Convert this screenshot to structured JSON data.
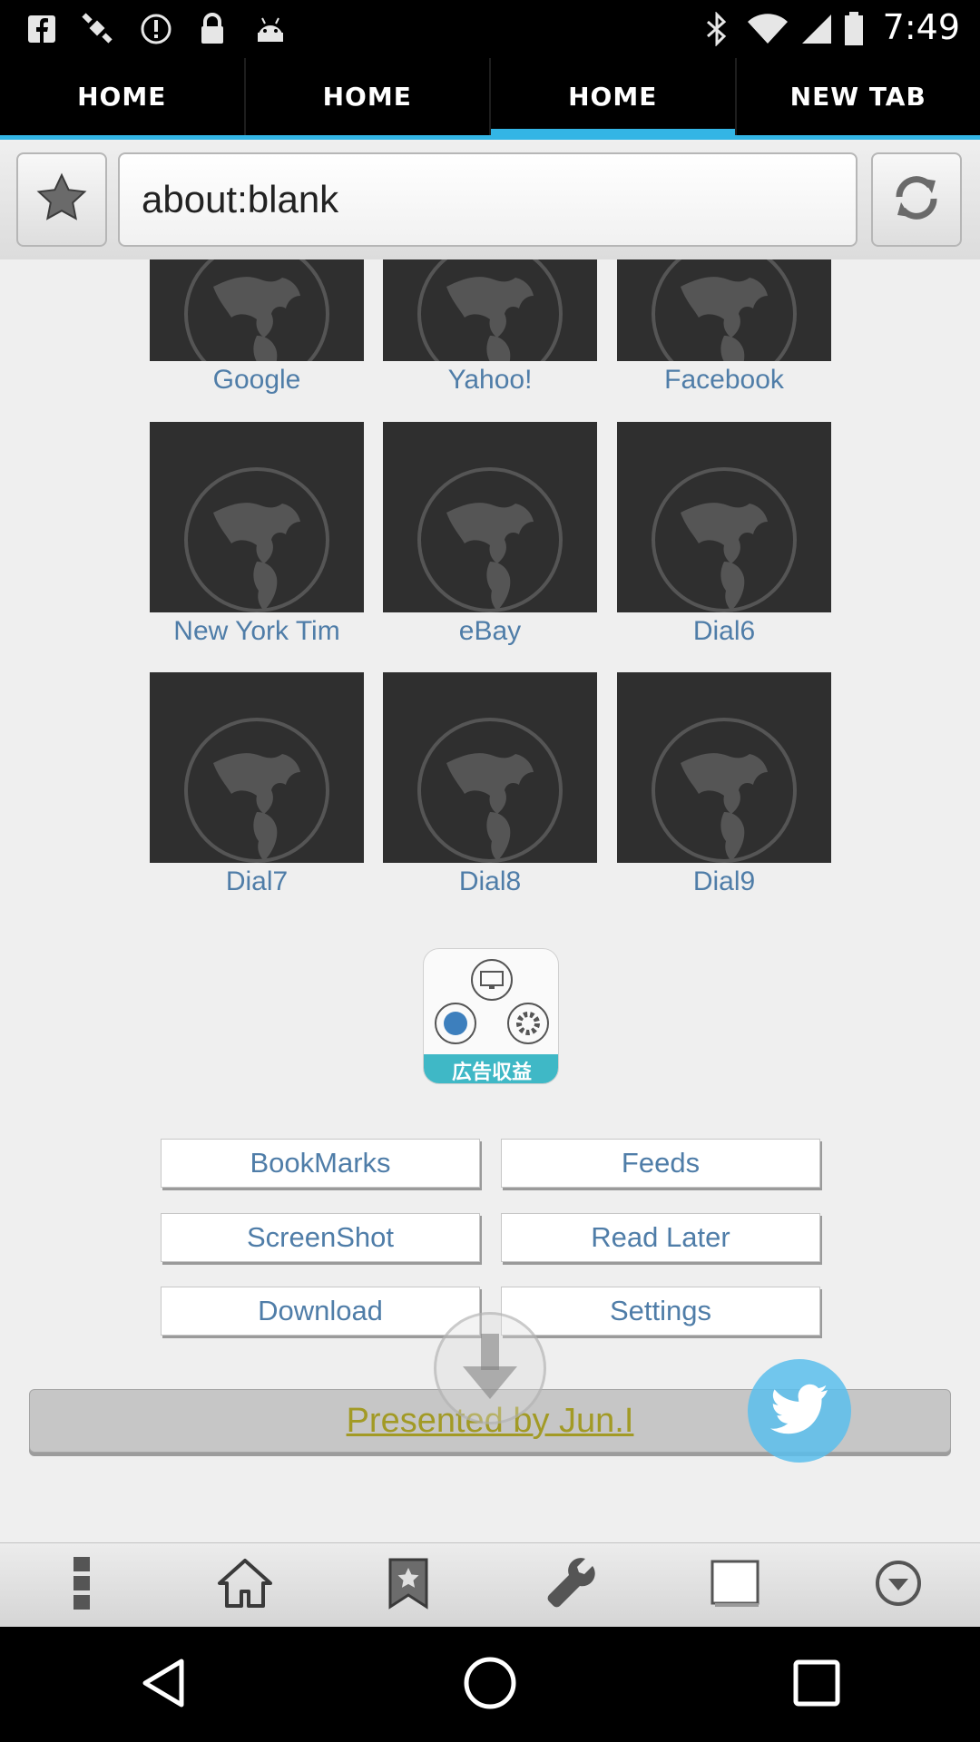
{
  "status_bar": {
    "time": "7:49",
    "icons": [
      "facebook-icon",
      "satellite-icon",
      "alert-icon",
      "lock-icon",
      "android-icon",
      "bluetooth-icon",
      "wifi-icon",
      "signal-icon",
      "battery-icon"
    ]
  },
  "tabs": [
    {
      "label": "HOME",
      "active": false
    },
    {
      "label": "HOME",
      "active": false
    },
    {
      "label": "HOME",
      "active": true
    },
    {
      "label": "NEW TAB",
      "active": false
    }
  ],
  "url_bar": {
    "value": "about:blank",
    "left_icon": "star-icon",
    "right_icon": "refresh-icon"
  },
  "speed_dials": [
    {
      "label": "Google"
    },
    {
      "label": "Yahoo!"
    },
    {
      "label": "Facebook"
    },
    {
      "label": "New York Tim"
    },
    {
      "label": "eBay"
    },
    {
      "label": "Dial6"
    },
    {
      "label": "Dial7"
    },
    {
      "label": "Dial8"
    },
    {
      "label": "Dial9"
    }
  ],
  "ad_icon": {
    "caption": "広告収益"
  },
  "menu_buttons": [
    {
      "label": "BookMarks"
    },
    {
      "label": "Feeds"
    },
    {
      "label": "ScreenShot"
    },
    {
      "label": "Read Later"
    },
    {
      "label": "Download"
    },
    {
      "label": "Settings"
    }
  ],
  "presented": {
    "text": "Presented by Jun.I"
  },
  "toolbar": [
    "more-icon",
    "home-icon",
    "bookmark-icon",
    "wrench-icon",
    "tabs-icon",
    "dropdown-icon"
  ],
  "colors": {
    "accent": "#33b5e5",
    "link": "#4f7da8",
    "presented": "#a29a25",
    "thumb": "#2f2f2f",
    "twitter": "#5abeec"
  }
}
